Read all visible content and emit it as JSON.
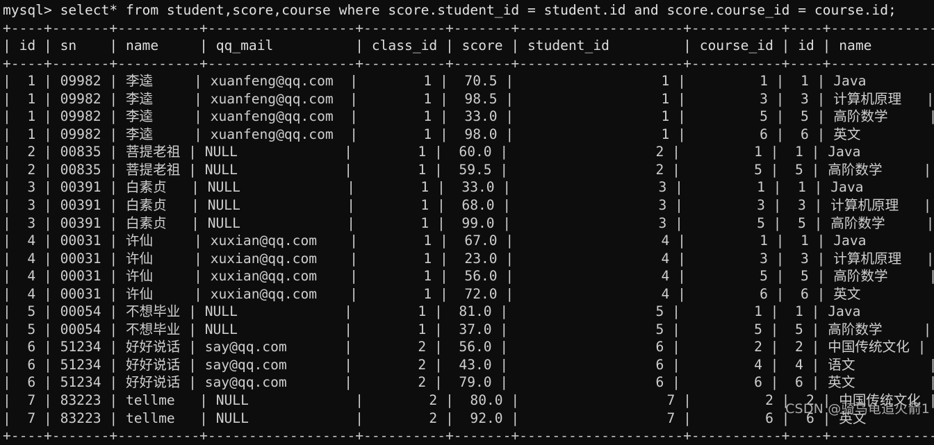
{
  "terminal": {
    "prompt": "mysql> ",
    "query": "select* from student,score,course where score.student_id = student.id and score.course_id = course.id;",
    "background_color": "#0d0d0d",
    "text_color": "#cfcfcf"
  },
  "table": {
    "columns": [
      {
        "name": "id",
        "width": 2,
        "align": "right"
      },
      {
        "name": "sn",
        "width": 5,
        "align": "left"
      },
      {
        "name": "name",
        "width": 8,
        "align": "left"
      },
      {
        "name": "qq_mail",
        "width": 16,
        "align": "left"
      },
      {
        "name": "class_id",
        "width": 8,
        "align": "right"
      },
      {
        "name": "score",
        "width": 5,
        "align": "right"
      },
      {
        "name": "student_id",
        "width": 18,
        "align": "right"
      },
      {
        "name": "course_id",
        "width": 9,
        "align": "right"
      },
      {
        "name": "id",
        "width": 2,
        "align": "right"
      },
      {
        "name": "name",
        "width": 12,
        "align": "left"
      }
    ],
    "headers": [
      "id",
      "sn",
      "name",
      "qq_mail",
      "class_id",
      "score",
      "student_id",
      "course_id",
      "id",
      "name"
    ],
    "rows": [
      [
        "1",
        "09982",
        "李逵",
        "xuanfeng@qq.com",
        "1",
        "70.5",
        "1",
        "1",
        "1",
        "Java"
      ],
      [
        "1",
        "09982",
        "李逵",
        "xuanfeng@qq.com",
        "1",
        "98.5",
        "1",
        "3",
        "3",
        "计算机原理"
      ],
      [
        "1",
        "09982",
        "李逵",
        "xuanfeng@qq.com",
        "1",
        "33.0",
        "1",
        "5",
        "5",
        "高阶数学"
      ],
      [
        "1",
        "09982",
        "李逵",
        "xuanfeng@qq.com",
        "1",
        "98.0",
        "1",
        "6",
        "6",
        "英文"
      ],
      [
        "2",
        "00835",
        "菩提老祖",
        "NULL",
        "1",
        "60.0",
        "2",
        "1",
        "1",
        "Java"
      ],
      [
        "2",
        "00835",
        "菩提老祖",
        "NULL",
        "1",
        "59.5",
        "2",
        "5",
        "5",
        "高阶数学"
      ],
      [
        "3",
        "00391",
        "白素贞",
        "NULL",
        "1",
        "33.0",
        "3",
        "1",
        "1",
        "Java"
      ],
      [
        "3",
        "00391",
        "白素贞",
        "NULL",
        "1",
        "68.0",
        "3",
        "3",
        "3",
        "计算机原理"
      ],
      [
        "3",
        "00391",
        "白素贞",
        "NULL",
        "1",
        "99.0",
        "3",
        "5",
        "5",
        "高阶数学"
      ],
      [
        "4",
        "00031",
        "许仙",
        "xuxian@qq.com",
        "1",
        "67.0",
        "4",
        "1",
        "1",
        "Java"
      ],
      [
        "4",
        "00031",
        "许仙",
        "xuxian@qq.com",
        "1",
        "23.0",
        "4",
        "3",
        "3",
        "计算机原理"
      ],
      [
        "4",
        "00031",
        "许仙",
        "xuxian@qq.com",
        "1",
        "56.0",
        "4",
        "5",
        "5",
        "高阶数学"
      ],
      [
        "4",
        "00031",
        "许仙",
        "xuxian@qq.com",
        "1",
        "72.0",
        "4",
        "6",
        "6",
        "英文"
      ],
      [
        "5",
        "00054",
        "不想毕业",
        "NULL",
        "1",
        "81.0",
        "5",
        "1",
        "1",
        "Java"
      ],
      [
        "5",
        "00054",
        "不想毕业",
        "NULL",
        "1",
        "37.0",
        "5",
        "5",
        "5",
        "高阶数学"
      ],
      [
        "6",
        "51234",
        "好好说话",
        "say@qq.com",
        "2",
        "56.0",
        "6",
        "2",
        "2",
        "中国传统文化"
      ],
      [
        "6",
        "51234",
        "好好说话",
        "say@qq.com",
        "2",
        "43.0",
        "6",
        "4",
        "4",
        "语文"
      ],
      [
        "6",
        "51234",
        "好好说话",
        "say@qq.com",
        "2",
        "79.0",
        "6",
        "6",
        "6",
        "英文"
      ],
      [
        "7",
        "83223",
        "tellme",
        "NULL",
        "2",
        "80.0",
        "7",
        "2",
        "2",
        "中国传统文化"
      ],
      [
        "7",
        "83223",
        "tellme",
        "NULL",
        "2",
        "92.0",
        "7",
        "6",
        "6",
        "英文"
      ]
    ]
  },
  "watermark": {
    "text": "CSDN @骑乌龟追火箭1"
  }
}
